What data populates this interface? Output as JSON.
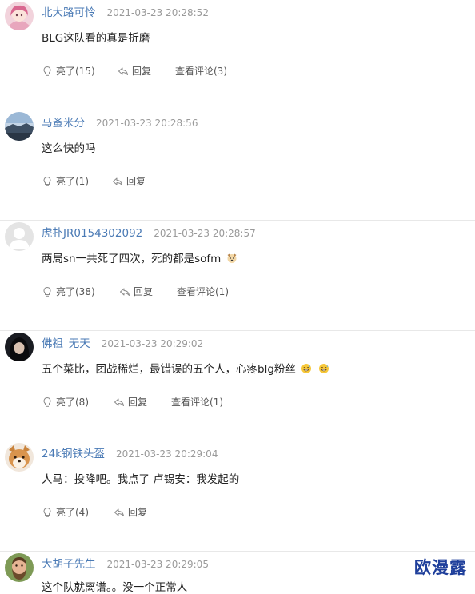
{
  "comments": [
    {
      "username": "北大路可怜",
      "time": "2021-03-23 20:28:52",
      "content": "BLG这队看的真是折磨",
      "emojis": [],
      "like_label": "亮了(15)",
      "reply_label": "回复",
      "view_label": "查看评论(3)",
      "avatar_style": "pink-girl"
    },
    {
      "username": "马蚤米分",
      "time": "2021-03-23 20:28:56",
      "content": "这么快的吗",
      "emojis": [],
      "like_label": "亮了(1)",
      "reply_label": "回复",
      "view_label": "",
      "avatar_style": "sky-landscape"
    },
    {
      "username": "虎扑JR0154302092",
      "time": "2021-03-23 20:28:57",
      "content": "两局sn一共死了四次，死的都是sofm",
      "emojis": [
        "dog-emoji"
      ],
      "like_label": "亮了(38)",
      "reply_label": "回复",
      "view_label": "查看评论(1)",
      "avatar_style": "default-gray"
    },
    {
      "username": "佛祖_无天",
      "time": "2021-03-23 20:29:02",
      "content": "五个菜比，团战稀烂，最错误的五个人，心疼blg粉丝",
      "emojis": [
        "grin-sweat-emoji",
        "grin-sweat-emoji"
      ],
      "like_label": "亮了(8)",
      "reply_label": "回复",
      "view_label": "查看评论(1)",
      "avatar_style": "dark-hair"
    },
    {
      "username": "24k钢铁头盔",
      "time": "2021-03-23 20:29:04",
      "content": "人马：投降吧。我点了 卢锡安：我发起的",
      "emojis": [],
      "like_label": "亮了(4)",
      "reply_label": "回复",
      "view_label": "",
      "avatar_style": "shiba-dog"
    },
    {
      "username": "大胡子先生",
      "time": "2021-03-23 20:29:05",
      "content": "这个队就离谱。。没一个正常人",
      "emojis": [],
      "like_label": "",
      "reply_label": "",
      "view_label": "",
      "avatar_style": "bearded-man"
    }
  ],
  "watermark": "欧漫露",
  "colors": {
    "username": "#4a7ab5",
    "time": "#9a9a9a",
    "divider": "#e8e8e8",
    "watermark": "#1f3f9b"
  }
}
